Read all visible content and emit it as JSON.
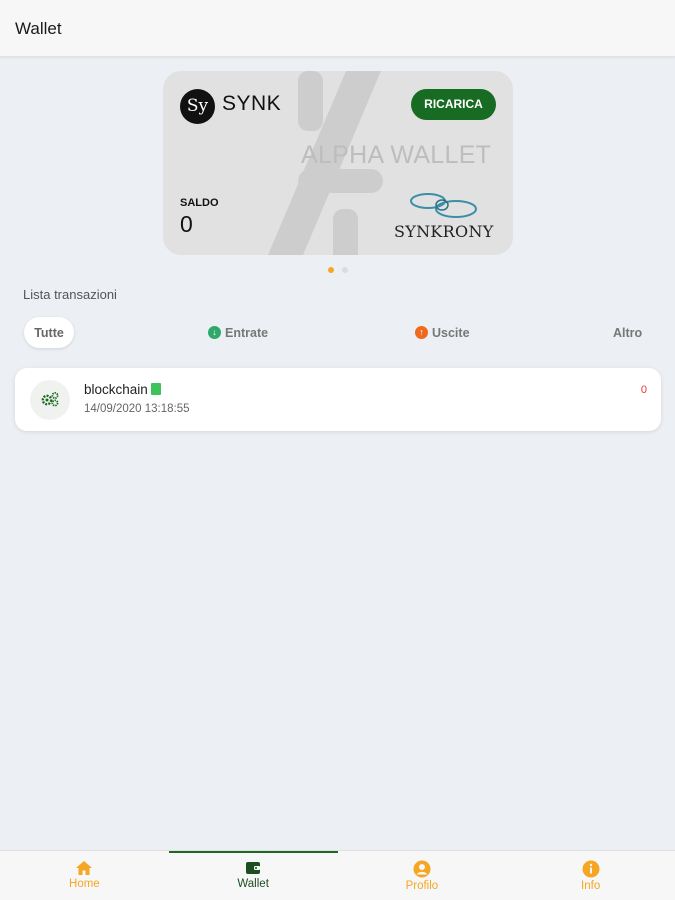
{
  "app_bar": {
    "title": "Wallet"
  },
  "card": {
    "brand": "SYNK",
    "brand_logo_text": "Sy",
    "topup_label": "RICARICA",
    "title": "ALPHA WALLET",
    "balance_label": "SALDO",
    "balance_value": "0",
    "logo_text": "SYNKRONY"
  },
  "carousel": {
    "pages": 2,
    "active": 1
  },
  "transactions": {
    "section_title": "Lista transazioni",
    "filters": [
      {
        "label": "Tutte",
        "icon": "",
        "active": true
      },
      {
        "label": "Entrate",
        "icon": "arrow-down-icon",
        "active": false
      },
      {
        "label": "Uscite",
        "icon": "arrow-up-icon",
        "active": false
      },
      {
        "label": "Altro",
        "icon": "",
        "active": false
      }
    ],
    "items": [
      {
        "name": "blockchain",
        "date": "14/09/2020 13:18:55",
        "amount": "0",
        "icon": "cogs-icon"
      }
    ]
  },
  "bottom_nav": [
    {
      "label": "Home",
      "icon": "home-icon"
    },
    {
      "label": "Wallet",
      "icon": "wallet-icon",
      "active": true
    },
    {
      "label": "Profilo",
      "icon": "user-circle-icon"
    },
    {
      "label": "Info",
      "icon": "info-icon"
    }
  ],
  "colors": {
    "accent": "#f5a623",
    "primary_green": "#176b22",
    "background": "#eceff3",
    "income": "#2fa86b",
    "expense": "#f06a1d",
    "amount": "#e53935"
  }
}
